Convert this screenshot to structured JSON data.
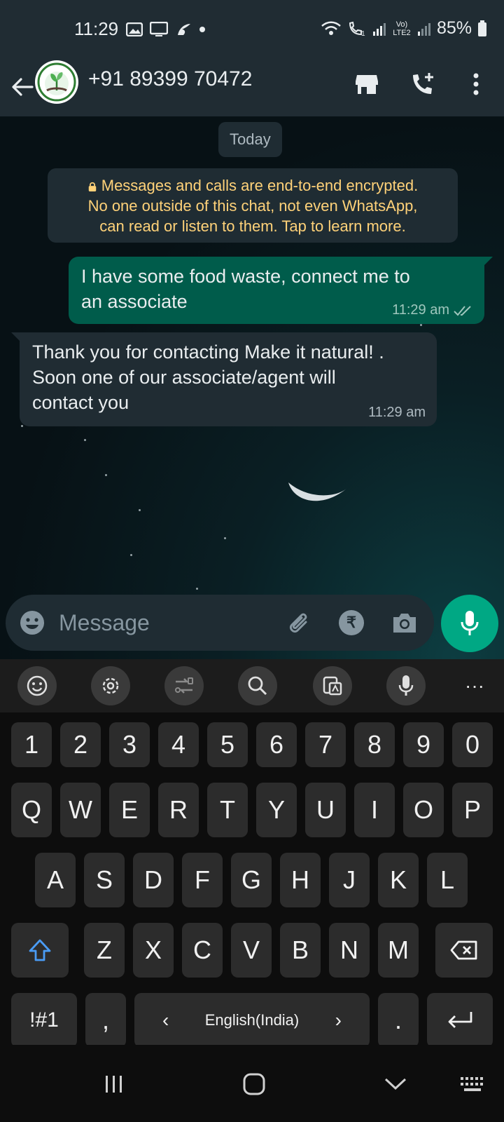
{
  "status_bar": {
    "time": "11:29",
    "battery": "85%",
    "network_label": "Vo) LTE2"
  },
  "header": {
    "contact": "+91 89399 70472",
    "icons": [
      "back-arrow-icon",
      "store-icon",
      "add-call-icon",
      "more-vertical-icon"
    ]
  },
  "chat": {
    "date_chip": "Today",
    "encryption_notice_line1": "Messages and calls are end-to-end encrypted.",
    "encryption_notice_line2": "No one outside of this chat, not even WhatsApp,",
    "encryption_notice_line3": "can read or listen to them. Tap to learn more.",
    "messages": [
      {
        "direction": "outgoing",
        "line1": "I have some food waste, connect me to",
        "line2": "an associate",
        "time": "11:29 am",
        "status": "read"
      },
      {
        "direction": "incoming",
        "line1": "Thank you for contacting Make it natural! .",
        "line2": "Soon one of our associate/agent will",
        "line3": "contact you",
        "time": "11:29 am"
      }
    ]
  },
  "composer": {
    "placeholder": "Message",
    "rupee_symbol": "₹"
  },
  "keyboard": {
    "toolbar": [
      "emoji-icon",
      "settings-icon",
      "translate-icon",
      "search-icon",
      "clipboard-icon",
      "voice-icon",
      "more-icon"
    ],
    "more": "···",
    "numbers": [
      "1",
      "2",
      "3",
      "4",
      "5",
      "6",
      "7",
      "8",
      "9",
      "0"
    ],
    "row1": [
      "Q",
      "W",
      "E",
      "R",
      "T",
      "Y",
      "U",
      "I",
      "O",
      "P"
    ],
    "row2": [
      "A",
      "S",
      "D",
      "F",
      "G",
      "H",
      "J",
      "K",
      "L"
    ],
    "row3": [
      "Z",
      "X",
      "C",
      "V",
      "B",
      "N",
      "M"
    ],
    "symbols_key": "!#1",
    "comma_key": ",",
    "language": "English(India)",
    "lang_left": "‹",
    "lang_right": "›",
    "period_key": "."
  },
  "colors": {
    "outgoing_bubble": "#005c4b",
    "incoming_bubble": "#202c33",
    "accent": "#00a884",
    "notice_text": "#ffd279"
  }
}
